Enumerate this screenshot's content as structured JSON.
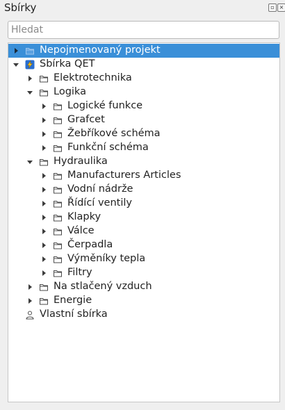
{
  "panel": {
    "title": "Sbírky",
    "float_icon": "float-icon",
    "close_icon": "close-icon"
  },
  "search": {
    "placeholder": "Hledat",
    "value": ""
  },
  "colors": {
    "selection": "#3a8fd8",
    "lightning": "#f2c21b",
    "lightning_bg": "#2a6fd0"
  },
  "tree": {
    "items": [
      {
        "label": "Nepojmenovaný projekt",
        "level": 0,
        "expander": "collapsed",
        "icon": "project-icon",
        "selected": true
      },
      {
        "label": "Sbírka QET",
        "level": 0,
        "expander": "expanded",
        "icon": "qet-lightning-icon"
      },
      {
        "label": "Elektrotechnika",
        "level": 1,
        "expander": "collapsed",
        "icon": "folder-icon"
      },
      {
        "label": "Logika",
        "level": 1,
        "expander": "expanded",
        "icon": "folder-icon"
      },
      {
        "label": "Logické funkce",
        "level": 2,
        "expander": "collapsed",
        "icon": "folder-icon"
      },
      {
        "label": "Grafcet",
        "level": 2,
        "expander": "collapsed",
        "icon": "folder-icon"
      },
      {
        "label": "Žebříkové schéma",
        "level": 2,
        "expander": "collapsed",
        "icon": "folder-icon"
      },
      {
        "label": "Funkční schéma",
        "level": 2,
        "expander": "collapsed",
        "icon": "folder-icon"
      },
      {
        "label": "Hydraulika",
        "level": 1,
        "expander": "expanded",
        "icon": "folder-icon"
      },
      {
        "label": "Manufacturers Articles",
        "level": 2,
        "expander": "collapsed",
        "icon": "folder-icon"
      },
      {
        "label": "Vodní nádrže",
        "level": 2,
        "expander": "collapsed",
        "icon": "folder-icon"
      },
      {
        "label": "Řídící ventily",
        "level": 2,
        "expander": "collapsed",
        "icon": "folder-icon"
      },
      {
        "label": "Klapky",
        "level": 2,
        "expander": "collapsed",
        "icon": "folder-icon"
      },
      {
        "label": "Válce",
        "level": 2,
        "expander": "collapsed",
        "icon": "folder-icon"
      },
      {
        "label": "Čerpadla",
        "level": 2,
        "expander": "collapsed",
        "icon": "folder-icon"
      },
      {
        "label": "Výměníky tepla",
        "level": 2,
        "expander": "collapsed",
        "icon": "folder-icon"
      },
      {
        "label": "Filtry",
        "level": 2,
        "expander": "collapsed",
        "icon": "folder-icon"
      },
      {
        "label": "Na stlačený vzduch",
        "level": 1,
        "expander": "collapsed",
        "icon": "folder-icon"
      },
      {
        "label": "Energie",
        "level": 1,
        "expander": "collapsed",
        "icon": "folder-icon"
      },
      {
        "label": "Vlastní sbírka",
        "level": 0,
        "expander": "none",
        "icon": "user-icon"
      }
    ]
  }
}
